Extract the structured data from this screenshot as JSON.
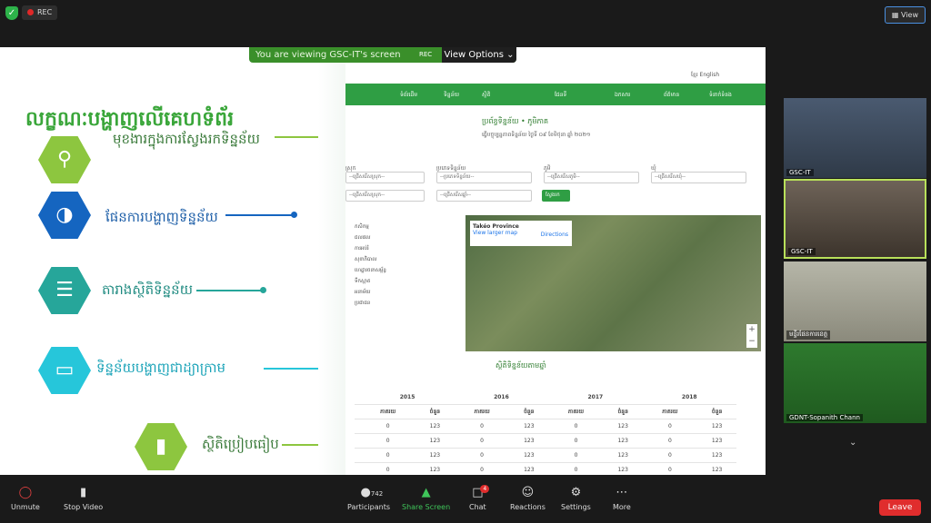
{
  "top": {
    "rec": "REC",
    "view": "View"
  },
  "banner": {
    "message": "You are viewing GSC-IT's screen",
    "rec": "REC",
    "view_options": "View Options"
  },
  "slide": {
    "title": "លក្ខណៈបង្ហាញលើគេហទំព័រ",
    "features": [
      {
        "label": "មុខងារក្នុងការស្វែងរកទិន្នន័យ",
        "icon": "search-icon",
        "color": "#8dc63f"
      },
      {
        "label": "ផែនការបង្ហាញទិន្នន័យ",
        "icon": "globe-icon",
        "color": "#1565c0"
      },
      {
        "label": "តារាងស្ថិតិទិន្នន័យ",
        "icon": "notepad-icon",
        "color": "#26a69a"
      },
      {
        "label": "ទិន្នន័យបង្ហាញជាដ្យាក្រាម",
        "icon": "presentation-icon",
        "color": "#26c6da"
      },
      {
        "label": "ស្ថិតិប្រៀបធៀប",
        "icon": "bar-chart-icon",
        "color": "#8dc63f"
      }
    ],
    "accent": "#3aa63a"
  },
  "web": {
    "lang": "ខ្មែរ  English",
    "nav": [
      "ទំព័រដើម",
      "ទិន្នន័យ",
      "ស្ថិតិ",
      "ផែនទី",
      "ឯកសារ",
      "ព័ត៌មាន",
      "ទំនាក់ទំនង"
    ],
    "title": "ប្រព័ន្ធទិន្នន័យ • ភូមិភាគ",
    "date": "ធ្វើបច្ចុប្បន្នភាពទិន្នន័យ ថ្ងៃទី ០៩ ខែមិថុនា ឆ្នាំ ២០២១",
    "filter_labels": [
      "ស្រុក",
      "ប្រភេទទិន្នន័យ",
      "ភូមិ",
      "ឃុំ"
    ],
    "filter_values": [
      "--ជ្រើសរើសស្រុក--",
      "--ប្រភេទទិន្នន័យ--",
      "--ជ្រើសរើសភូមិ--",
      "--ជ្រើសរើសឃុំ--",
      "--ជ្រើសរើសស្រុក--",
      "--ជ្រើសរើសឆ្នាំ--"
    ],
    "search_btn": "ស្វែងរក",
    "tree": [
      "កសិកម្ម",
      "ជលផល",
      "ការអប់រំ",
      "សុខាភិបាល",
      "ហេដ្ឋារចនាសម្ព័ន្ធ",
      "ទឹកស្អាត",
      "អនាម័យ",
      "ប្រជាជន"
    ],
    "map_title": "Takéo Province",
    "map_link": "View larger map",
    "map_dir": "Directions",
    "section_title": "ស្ថិតិទិន្នន័យតាមឆ្នាំ",
    "table": {
      "years": [
        "2015",
        "2016",
        "2017",
        "2018"
      ],
      "sub": [
        "ភាគរយ",
        "ចំនួន"
      ],
      "rows": [
        [
          "0",
          "123",
          "0",
          "123",
          "0",
          "123",
          "0",
          "123"
        ],
        [
          "0",
          "123",
          "0",
          "123",
          "0",
          "123",
          "0",
          "123"
        ],
        [
          "0",
          "123",
          "0",
          "123",
          "0",
          "123",
          "0",
          "123"
        ],
        [
          "0",
          "123",
          "0",
          "123",
          "0",
          "123",
          "0",
          "123"
        ]
      ]
    }
  },
  "tiles": [
    {
      "name": "GSC-IT"
    },
    {
      "name": "GSC-IT"
    },
    {
      "name": "មន្ទីរផែនការខេត្ត"
    },
    {
      "name": "GDNT-Sopanith Chann"
    }
  ],
  "toolbar": {
    "unmute": "Unmute",
    "stop_video": "Stop Video",
    "participants_count": "742",
    "participants": "Participants",
    "share": "Share Screen",
    "chat": "Chat",
    "chat_badge": "4",
    "reactions": "Reactions",
    "settings": "Settings",
    "more": "More",
    "leave": "Leave"
  }
}
